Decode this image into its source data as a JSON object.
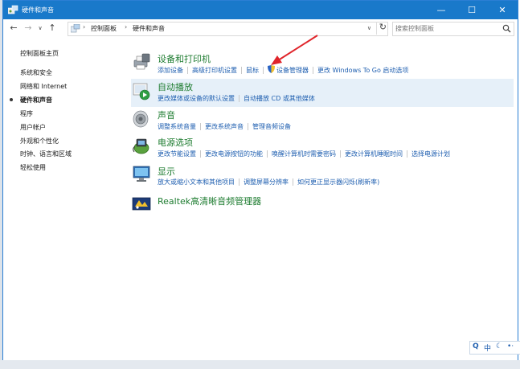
{
  "window": {
    "title": "硬件和声音",
    "controls": {
      "minimize": "—",
      "maximize": "☐",
      "close": "✕"
    }
  },
  "nav": {
    "back": "←",
    "forward": "→",
    "recent": "∨",
    "up": "↑",
    "refresh": "↻",
    "breadcrumbs": [
      "控制面板",
      "硬件和声音"
    ],
    "separator": "›",
    "dropdown": "∨"
  },
  "search": {
    "placeholder": "搜索控制面板"
  },
  "sidebar": {
    "items": [
      {
        "label": "控制面板主页"
      },
      {
        "label": "系统和安全"
      },
      {
        "label": "网络和 Internet"
      },
      {
        "label": "硬件和声音",
        "current": true
      },
      {
        "label": "程序"
      },
      {
        "label": "用户帐户"
      },
      {
        "label": "外观和个性化"
      },
      {
        "label": "时钟、语言和区域"
      },
      {
        "label": "轻松使用"
      }
    ]
  },
  "categories": [
    {
      "title": "设备和打印机",
      "icon": "printer-icon",
      "links": [
        "添加设备",
        "高级打印机设置",
        "鼠标",
        "设备管理器",
        "更改 Windows To Go 启动选项"
      ]
    },
    {
      "title": "自动播放",
      "icon": "autoplay-icon",
      "links": [
        "更改媒体或设备的默认设置",
        "自动播放 CD 或其他媒体"
      ]
    },
    {
      "title": "声音",
      "icon": "speaker-icon",
      "links": [
        "调整系统音量",
        "更改系统声音",
        "管理音频设备"
      ]
    },
    {
      "title": "电源选项",
      "icon": "power-options-icon",
      "links": [
        "更改节能设置",
        "更改电源按钮的功能",
        "唤醒计算机时需要密码",
        "更改计算机睡眠时间",
        "选择电源计划"
      ]
    },
    {
      "title": "显示",
      "icon": "display-icon",
      "links": [
        "放大或缩小文本和其他项目",
        "调整屏幕分辨率",
        "如何更正显示器闪烁(刷新率)"
      ]
    },
    {
      "title": "Realtek高清晰音频管理器",
      "icon": "realtek-audio-icon",
      "links": []
    }
  ],
  "tray": {
    "search": "Q",
    "ime": "中",
    "moon": "☾",
    "dots": "•‧"
  },
  "colors": {
    "titlebar": "#1979ca",
    "category_title": "#1e7c30",
    "link": "#1f5fb0",
    "highlight": "#e6f0f9",
    "annotation_arrow": "#e0242a"
  }
}
